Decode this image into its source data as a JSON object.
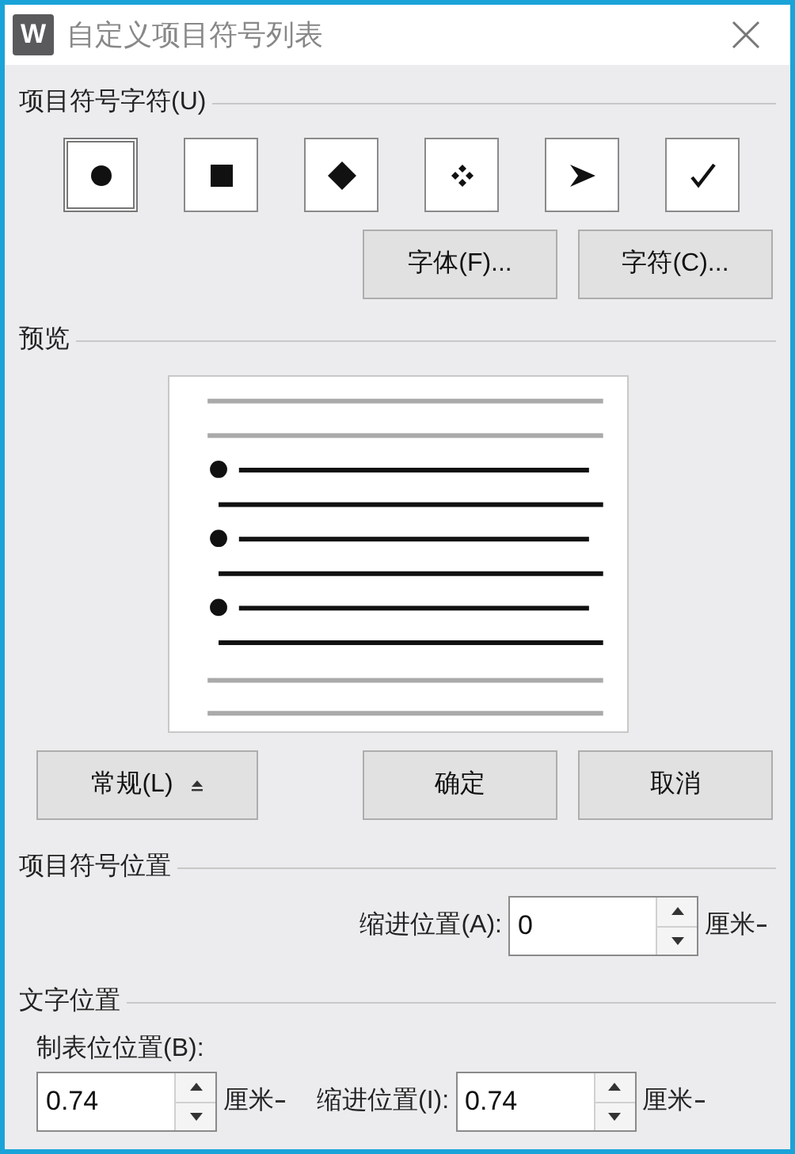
{
  "window": {
    "logo": "W",
    "title": "自定义项目符号列表"
  },
  "bullet_section": {
    "title": "项目符号字符(U)",
    "bullets": [
      {
        "kind": "dot",
        "selected": true
      },
      {
        "kind": "square",
        "selected": false
      },
      {
        "kind": "diamond",
        "selected": false
      },
      {
        "kind": "four-diamonds",
        "selected": false
      },
      {
        "kind": "arrowhead",
        "selected": false
      },
      {
        "kind": "check",
        "selected": false
      }
    ],
    "buttons": [
      "字体(F)...",
      "字符(C)..."
    ]
  },
  "preview": {
    "title": "预览"
  },
  "buttons": {
    "more": "常规(L)",
    "ok": "确定",
    "cancel": "取消"
  },
  "bullet_position": {
    "title": "项目符号位置",
    "indent_label": "缩进位置(A):",
    "indent_value": "0",
    "indent_unit": "厘米"
  },
  "text_position": {
    "title": "文字位置",
    "tab_label": "制表位位置(B):",
    "tab_value": "0.74",
    "tab_unit": "厘米",
    "indent_label": "缩进位置(I):",
    "indent_value": "0.74",
    "indent_unit": "厘米"
  }
}
